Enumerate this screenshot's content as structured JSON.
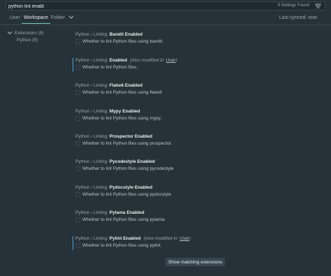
{
  "search": {
    "value": "python lint enabl",
    "result_count": "9 Settings Found"
  },
  "tabs": [
    {
      "label": "User"
    },
    {
      "label": "Workspace"
    },
    {
      "label": "Folder"
    }
  ],
  "sync_status": "Last synced: now",
  "toc": {
    "extensions_label": "Extensions (9)",
    "python_label": "Python (9)"
  },
  "settings": [
    {
      "category": "Python › Linting: ",
      "name": "Bandit Enabled",
      "modified": "",
      "modified_link": "",
      "description": "Whether to lint Python files using bandit."
    },
    {
      "category": "Python › Linting: ",
      "name": "Enabled",
      "modified": "(Also modified in: ",
      "modified_link": "User",
      "modified_suffix": ")",
      "description": "Whether to lint Python files."
    },
    {
      "category": "Python › Linting: ",
      "name": "Flake8 Enabled",
      "modified": "",
      "modified_link": "",
      "description": "Whether to lint Python files using flake8"
    },
    {
      "category": "Python › Linting: ",
      "name": "Mypy Enabled",
      "modified": "",
      "modified_link": "",
      "description": "Whether to lint Python files using mypy."
    },
    {
      "category": "Python › Linting: ",
      "name": "Prospector Enabled",
      "modified": "",
      "modified_link": "",
      "description": "Whether to lint Python files using prospector."
    },
    {
      "category": "Python › Linting: ",
      "name": "Pycodestyle Enabled",
      "modified": "",
      "modified_link": "",
      "description": "Whether to lint Python files using pycodestyle"
    },
    {
      "category": "Python › Linting: ",
      "name": "Pydocstyle Enabled",
      "modified": "",
      "modified_link": "",
      "description": "Whether to lint Python files using pydocstyle"
    },
    {
      "category": "Python › Linting: ",
      "name": "Pylama Enabled",
      "modified": "",
      "modified_link": "",
      "description": "Whether to lint Python files using pylama."
    },
    {
      "category": "Python › Linting: ",
      "name": "Pylint Enabled",
      "modified": "(Also modified in: ",
      "modified_link": "User",
      "modified_suffix": ")",
      "description": "Whether to lint Python files using pylint."
    }
  ],
  "show_extensions_label": "Show matching extensions",
  "colors": {
    "background": "#263238",
    "accent": "#80cbc4",
    "modified_bar": "#4fa3d8"
  }
}
